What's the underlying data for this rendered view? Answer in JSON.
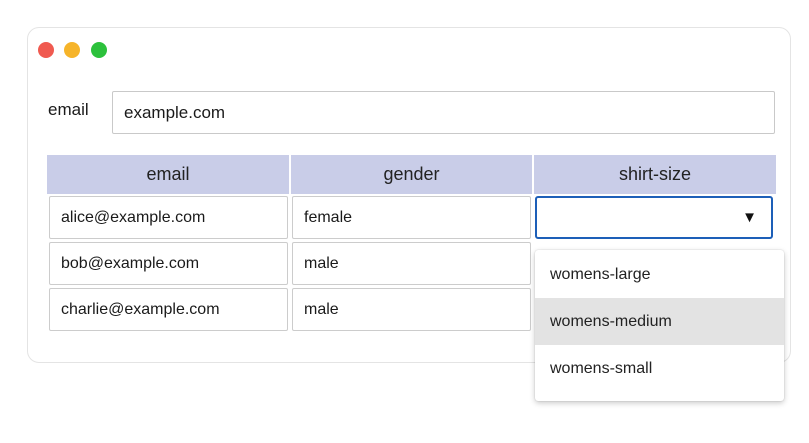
{
  "window": {
    "controls": {
      "close_color": "#f05a50",
      "minimize_color": "#f6b42a",
      "maximize_color": "#2cc13c"
    }
  },
  "filter": {
    "label": "email",
    "value": "example.com"
  },
  "table": {
    "columns": [
      "email",
      "gender",
      "shirt-size"
    ],
    "rows": [
      {
        "email": "alice@example.com",
        "gender": "female",
        "shirt_size": ""
      },
      {
        "email": "bob@example.com",
        "gender": "male",
        "shirt_size": ""
      },
      {
        "email": "charlie@example.com",
        "gender": "male",
        "shirt_size": ""
      }
    ],
    "header_color": "#c9cde8"
  },
  "dropdown": {
    "arrow": "▼",
    "options": [
      "womens-large",
      "womens-medium",
      "womens-small"
    ],
    "highlighted_option": "womens-medium",
    "focus_color": "#1d5fb8"
  }
}
